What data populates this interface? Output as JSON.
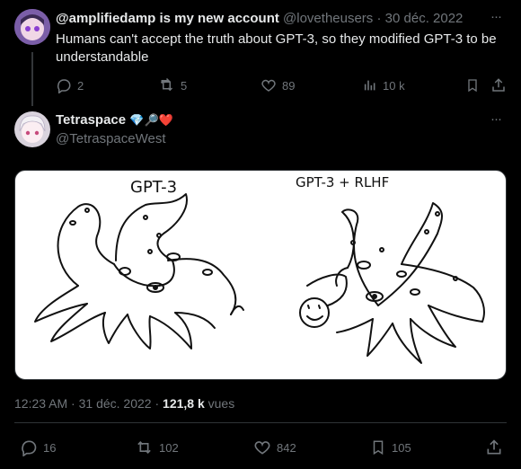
{
  "reply_tweet": {
    "display_name": "@amplifiedamp is my new account",
    "handle": "@lovetheusers",
    "separator": "·",
    "date": "30 déc. 2022",
    "more": "···",
    "text": "Humans can't accept the truth about GPT-3, so they modified GPT-3 to be understandable",
    "replies": "2",
    "retweets": "5",
    "likes": "89",
    "views": "10 k"
  },
  "main_tweet": {
    "display_name": "Tetraspace",
    "emoji": "💎🔎❤️",
    "handle": "@TetraspaceWest",
    "more": "···",
    "image_labels": {
      "left": "GPT-3",
      "right": "GPT-3 + RLHF"
    },
    "time": "12:23 AM",
    "separator1": "·",
    "date": "31 déc. 2022",
    "separator2": "·",
    "views_count": "121,8 k",
    "views_label": "vues",
    "replies": "16",
    "retweets": "102",
    "likes": "842",
    "bookmarks": "105"
  }
}
